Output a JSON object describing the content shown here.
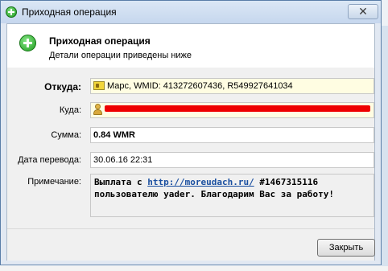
{
  "window": {
    "title": "Приходная операция",
    "close_glyph": "✕"
  },
  "header": {
    "title": "Приходная операция",
    "subtitle": "Детали операции приведены ниже"
  },
  "details": {
    "from_label": "Откуда:",
    "from_value": "Марс, WMID: 413272607436, R549927641034",
    "to_label": "Куда:",
    "amount_label": "Сумма:",
    "amount_value": "0.84 WMR",
    "date_label": "Дата перевода:",
    "date_value": "30.06.16 22:31",
    "note_label": "Примечание:",
    "note_prefix": "Выплата с ",
    "note_link": "http://moreudach.ru/",
    "note_suffix": " #1467315116 пользователю yader. Благодарим Вас за работу!"
  },
  "footer": {
    "close_label": "Закрыть"
  },
  "icons": {
    "window_icon": "plus-circle-green",
    "header_icon": "plus-circle-green",
    "from_icon": "webmoney-id-card",
    "to_icon": "person"
  },
  "colors": {
    "accent_green": "#1f9a1f",
    "link": "#1a4fa0",
    "redaction": "#ee0000",
    "highlight_field": "#fffde2"
  }
}
